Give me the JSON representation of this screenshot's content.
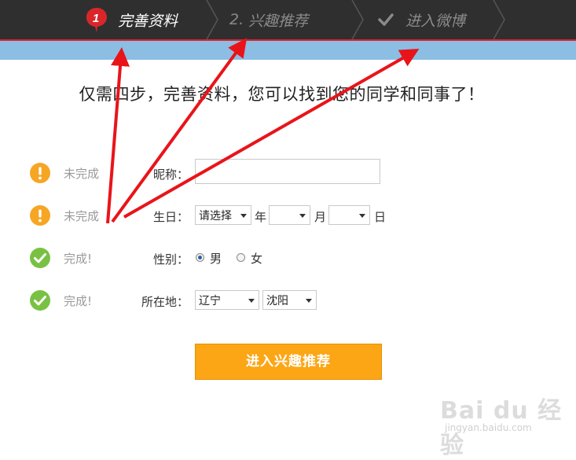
{
  "steps": {
    "step1": {
      "badge": "1",
      "label": "完善资料"
    },
    "step2": {
      "number": "2.",
      "label": "兴趣推荐"
    },
    "step3": {
      "label": "进入微博"
    }
  },
  "headline": "仅需四步，完善资料，您可以找到您的同学和同事了！",
  "rows": {
    "nickname": {
      "status": "未完成",
      "label": "昵称：",
      "value": ""
    },
    "birthday": {
      "status": "未完成",
      "label": "生日：",
      "year_value": "请选择",
      "year_unit": "年",
      "month_value": "",
      "month_unit": "月",
      "day_value": "",
      "day_unit": "日"
    },
    "gender": {
      "status": "完成!",
      "label": "性别：",
      "option_male": "男",
      "option_female": "女",
      "selected": "男"
    },
    "location": {
      "status": "完成!",
      "label": "所在地：",
      "province": "辽宁",
      "city": "沈阳"
    }
  },
  "submit_label": "进入兴趣推荐",
  "watermark": {
    "main": "Bai du 经验",
    "sub": "jingyan.baidu.com"
  },
  "colors": {
    "topbar": "#2f2f2f",
    "accent_red": "#d9262b",
    "bluebar": "#8cbde3",
    "warning_orange": "#f6a623",
    "success_green": "#79c143",
    "button_orange": "#fca615",
    "annotation_red": "#e8141a"
  }
}
